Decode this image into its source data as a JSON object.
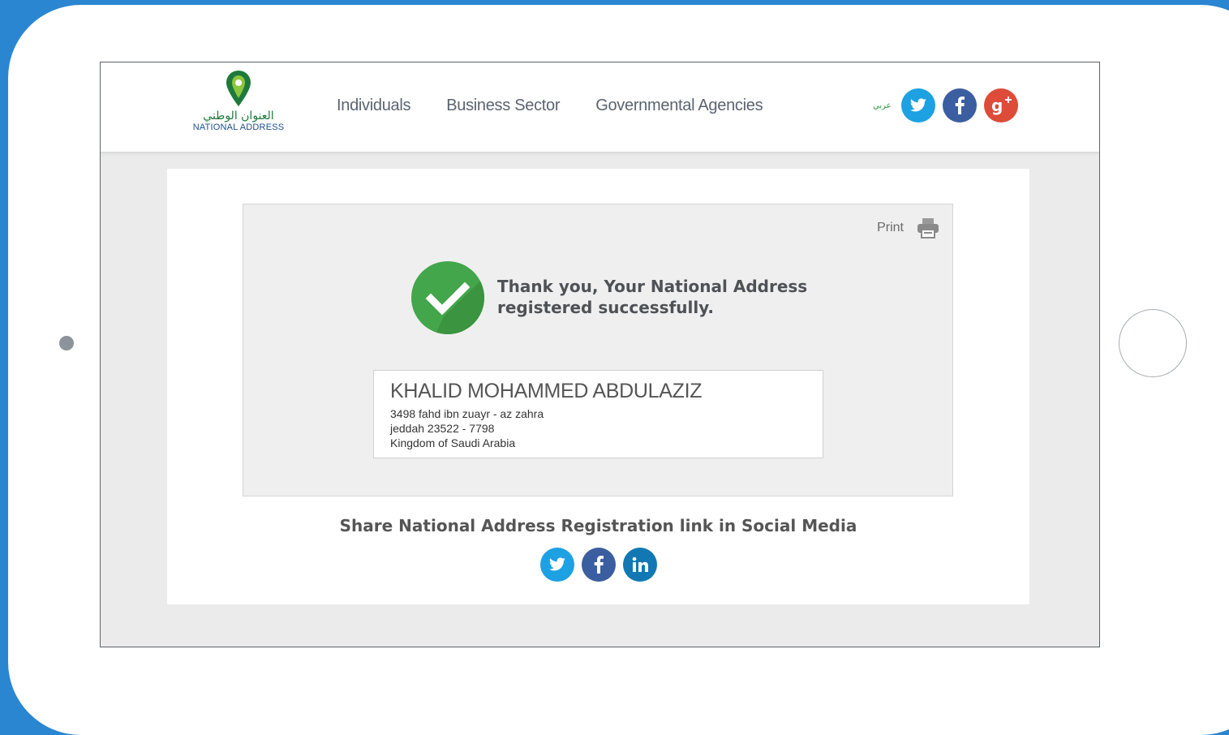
{
  "logo": {
    "arabic": "العنوان الوطني",
    "english": "NATIONAL ADDRESS"
  },
  "nav": {
    "items": [
      "Individuals",
      "Business Sector",
      "Governmental Agencies"
    ]
  },
  "header": {
    "language_label": "عربي"
  },
  "print": {
    "label": "Print"
  },
  "confirmation": {
    "line1": "Thank you, Your National Address",
    "line2": "registered successfully."
  },
  "address": {
    "name": "KHALID MOHAMMED ABDULAZIZ",
    "line1": "3498 fahd ibn zuayr - az zahra",
    "line2": "jeddah 23522 - 7798",
    "line3": "Kingdom of Saudi Arabia"
  },
  "share": {
    "title": "Share National Address Registration link in Social Media"
  },
  "icons": {
    "header": [
      "twitter-icon",
      "facebook-icon",
      "google-plus-icon"
    ],
    "share": [
      "twitter-icon",
      "facebook-icon",
      "linkedin-icon"
    ]
  },
  "colors": {
    "background": "#2a86d1",
    "brand_green": "#43a64a",
    "twitter": "#1da1e2",
    "facebook": "#3b5ea0",
    "google_plus": "#dd4b39",
    "linkedin": "#1178b3"
  }
}
